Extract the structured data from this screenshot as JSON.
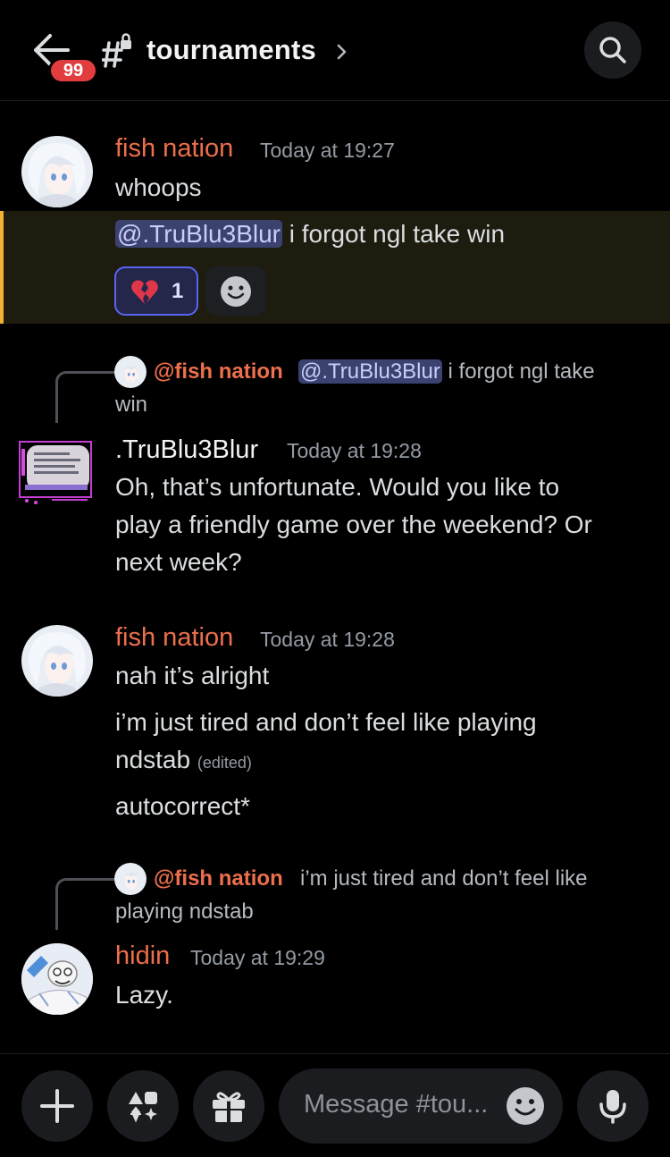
{
  "header": {
    "unread_badge": "99",
    "channel_name": "tournaments",
    "back_icon": "arrow-left-icon",
    "search_icon": "search-icon"
  },
  "messages": [
    {
      "author": "fish nation",
      "author_color": "#ed6f4c",
      "timestamp": "Today at 19:27",
      "lines": [
        "whoops"
      ],
      "highlight_mention": "@.TruBlu3Blur",
      "highlight_text": " i forgot ngl take win",
      "reaction": {
        "emoji": "broken-heart",
        "count": "1"
      }
    },
    {
      "reply": {
        "author": "@fish nation",
        "mention": "@.TruBlu3Blur",
        "text_a": " i forgot ngl take",
        "text_b": "win"
      },
      "author": ".TruBlu3Blur",
      "author_color": "#f2f3f5",
      "timestamp": "Today at 19:28",
      "lines": [
        "Oh, that’s unfortunate. Would you like to",
        "play a friendly game over the weekend? Or",
        "next week?"
      ]
    },
    {
      "author": "fish nation",
      "author_color": "#ed6f4c",
      "timestamp": "Today at 19:28",
      "lines": [
        "nah it’s alright",
        "i’m just tired and don’t feel like playing",
        "ndstab",
        "autocorrect*"
      ],
      "edited": "(edited)"
    },
    {
      "reply": {
        "author": "@fish nation",
        "text_a": "i’m just tired and don’t feel like",
        "text_b": "playing ndstab"
      },
      "author": "hidin",
      "author_color": "#ed6f4c",
      "timestamp": "Today at 19:29",
      "lines": [
        "Lazy."
      ]
    }
  ],
  "composer": {
    "placeholder": "Message #tou...",
    "plus_icon": "plus-icon",
    "apps_icon": "apps-icon",
    "gift_icon": "gift-icon",
    "mic_icon": "microphone-icon"
  }
}
